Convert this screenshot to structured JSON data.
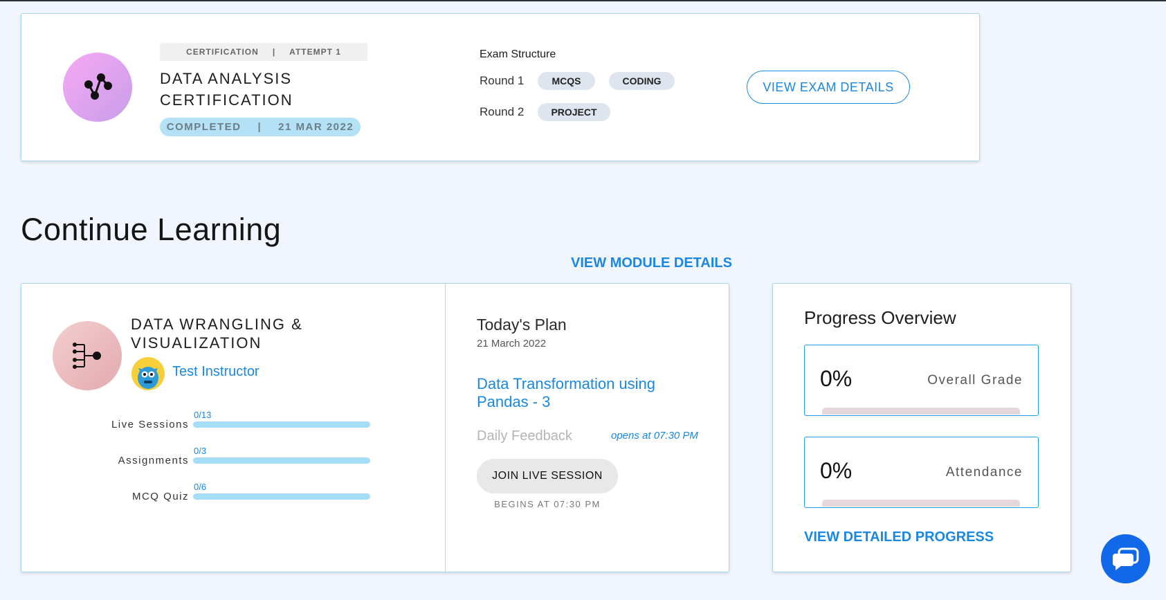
{
  "certification": {
    "type_label": "CERTIFICATION",
    "separator": "|",
    "attempt_label": "ATTEMPT 1",
    "title": "DATA ANALYSIS CERTIFICATION",
    "status": "COMPLETED",
    "date": "21 MAR 2022",
    "icon": "graph-nodes-icon",
    "exam_structure_label": "Exam Structure",
    "rounds": [
      {
        "label": "Round 1",
        "chips": [
          "MCQS",
          "CODING"
        ]
      },
      {
        "label": "Round 2",
        "chips": [
          "PROJECT"
        ]
      }
    ],
    "view_exam_details": "VIEW EXAM DETAILS"
  },
  "continue_learning": {
    "title": "Continue Learning",
    "view_module_details": "VIEW MODULE DETAILS"
  },
  "module": {
    "title": "DATA WRANGLING & VISUALIZATION",
    "icon": "tree-branch-icon",
    "instructor": "Test Instructor",
    "stats": [
      {
        "label": "Live Sessions",
        "value": "0/13",
        "fraction": 0
      },
      {
        "label": "Assignments",
        "value": "0/3",
        "fraction": 0
      },
      {
        "label": "MCQ Quiz",
        "value": "0/6",
        "fraction": 0
      }
    ]
  },
  "todays_plan": {
    "title": "Today's Plan",
    "date": "21 March 2022",
    "topic": "Data Transformation using Pandas - 3",
    "feedback_label": "Daily Feedback",
    "opens_at": "opens at 07:30 PM",
    "join_button": "JOIN LIVE SESSION",
    "begins_at": "BEGINS AT 07:30 PM"
  },
  "progress": {
    "title": "Progress Overview",
    "metrics": [
      {
        "value": "0%",
        "label": "Overall Grade",
        "fraction": 0
      },
      {
        "value": "0%",
        "label": "Attendance",
        "fraction": 0
      }
    ],
    "link": "VIEW DETAILED PROGRESS"
  },
  "colors": {
    "accent": "#1a87e0",
    "background": "#f1f5fd",
    "card_border": "#a9d8ea",
    "chat_button": "#1168e8"
  }
}
